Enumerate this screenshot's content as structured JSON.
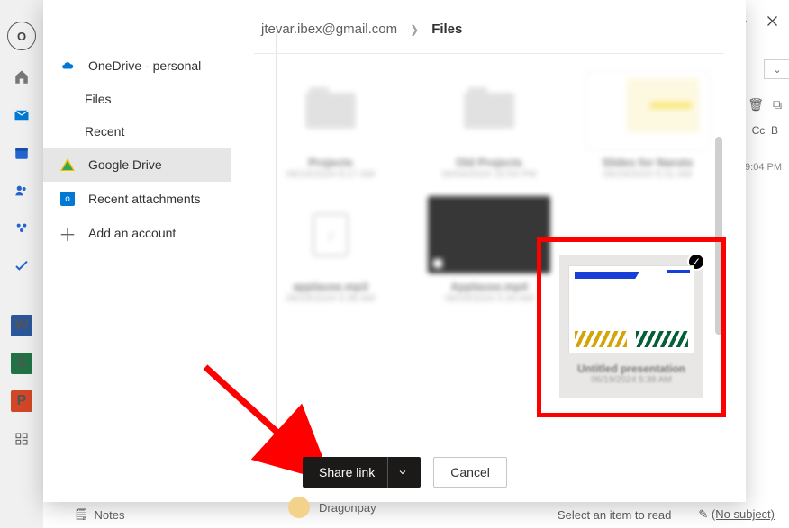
{
  "app_rail": {
    "outlook_badge": "O",
    "word_badge": "W",
    "excel_badge": "X",
    "ppt_badge": "P"
  },
  "background": {
    "cc_label": "Cc",
    "bcc_partial": "B",
    "compose_time_hint": "at 9:04 PM",
    "notes_label": "Notes",
    "select_read": "Select an item to read",
    "no_subject": "(No subject)",
    "dragonpay": "Dragonpay"
  },
  "dialog": {
    "sidebar": {
      "onedrive": "OneDrive - personal",
      "files": "Files",
      "recent": "Recent",
      "google_drive": "Google Drive",
      "recent_attachments": "Recent attachments",
      "add_account": "Add an account"
    },
    "breadcrumb": {
      "account": "jtevar.ibex@gmail.com",
      "current": "Files"
    },
    "files": [
      {
        "name": "Projects",
        "meta": "06/19/2024 8:17 AM"
      },
      {
        "name": "Old Projects",
        "meta": "06/04/2024 10:54 PM"
      },
      {
        "name": "Slides for Naruto",
        "meta": "06/19/2024 5:31 AM"
      },
      {
        "name": "applause.mp3",
        "meta": "06/19/2024 5:36 AM"
      },
      {
        "name": "Applause.mp4",
        "meta": "06/19/2024 5:34 AM"
      }
    ],
    "selected_file": {
      "name": "Untitled presentation",
      "meta": "06/19/2024 5:38 AM"
    },
    "footer": {
      "share_link": "Share link",
      "cancel": "Cancel"
    }
  }
}
